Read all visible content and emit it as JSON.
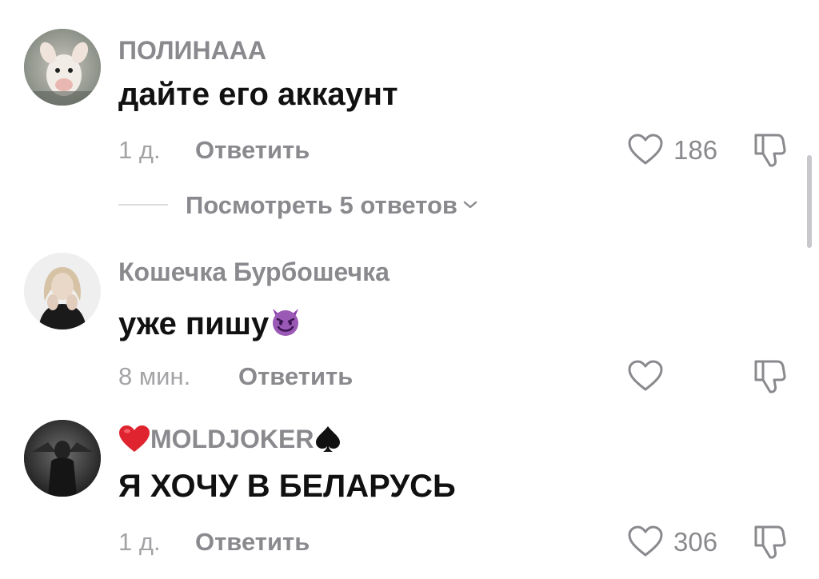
{
  "comments": [
    {
      "username": "ПОЛИНААА",
      "text": "дайте его аккаунт",
      "time": "1 д.",
      "reply_label": "Ответить",
      "likes": "186",
      "view_replies": "Посмотреть 5 ответов"
    },
    {
      "username": "Кошечка Бурбошечка",
      "text": "уже пишу",
      "text_emoji": "smiling-devil-emoji",
      "time": "8 мин.",
      "reply_label": "Ответить",
      "likes": ""
    },
    {
      "username": "MOLDJOKER",
      "username_prefix_emoji": "red-heart-emoji",
      "username_suffix_emoji": "spade-suit-emoji",
      "text": "Я ХОЧУ В БЕЛАРУСЬ",
      "time": "1 д.",
      "reply_label": "Ответить",
      "likes": "306"
    }
  ],
  "colors": {
    "username": "#8a8a8e",
    "text": "#111111",
    "meta": "#a3a3a6",
    "icon": "#8a8a8e"
  },
  "icons": [
    "heart-outline-icon",
    "dislike-icon",
    "chevron-down-icon"
  ]
}
